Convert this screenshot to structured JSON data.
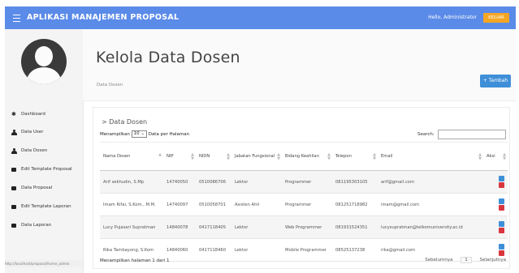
{
  "app": {
    "title": "APLIKASI MANAJEMEN PROPOSAL",
    "greeting": "Hello, Administrator",
    "logout_label": "KELUAR",
    "status_url": "http://localhost/proposal/home_admin"
  },
  "sidebar": {
    "items": [
      {
        "label": "Dashboard",
        "icon": "dashboard-icon"
      },
      {
        "label": "Data User",
        "icon": "user-icon"
      },
      {
        "label": "Data Dosen",
        "icon": "user-icon"
      },
      {
        "label": "Edit Template Proposal",
        "icon": "file-icon"
      },
      {
        "label": "Data Proposal",
        "icon": "file-icon"
      },
      {
        "label": "Edit Template Laporan",
        "icon": "file-icon"
      },
      {
        "label": "Data Laporan",
        "icon": "file-icon"
      }
    ]
  },
  "header": {
    "title": "Kelola Data Dosen",
    "breadcrumb": "Data Dosen",
    "add_button": "+ Tambah"
  },
  "panel": {
    "breadcrumb": "> Data Dosen",
    "length_prefix": "Menampilkan",
    "length_value": "10",
    "length_suffix": "Data per Halaman",
    "search_label": "Search:",
    "search_value": "",
    "columns": [
      "Nama Dosen",
      "NIP",
      "NIDN",
      "Jabatan Fungsional",
      "Bidang Keahlian",
      "Telepon",
      "Email",
      "Aksi"
    ],
    "rows": [
      [
        "Arif sekhudin, S.Mp",
        "14740050",
        "0510086706",
        "Lektor",
        "Programmer",
        "081195303105",
        "arif@gmail.com"
      ],
      [
        "Imam Rifai, S.Kom., M.M.",
        "14740097",
        "0510058701",
        "Asisten Ahli",
        "Programmer",
        "081251718982",
        "imam@gmail.com"
      ],
      [
        "Lucy Pujasari Supratman",
        "14840078",
        "0417118405",
        "Lektor",
        "Web Programmer",
        "081931524351",
        "lucysupratman@telkomuniversity.ac.id"
      ],
      [
        "Rika Tambayong, S.Kom",
        "14840060",
        "0417118460",
        "Lektor",
        "Mobile Programmer",
        "08525137238",
        "rika@gmail.com"
      ]
    ],
    "info": "Menampilkan halaman 1 dari 1",
    "prev": "Sebelumnya",
    "page": "1",
    "next": "Selanjutnya"
  },
  "colors": {
    "topbar": "#5b8be8",
    "logout": "#f5a623",
    "primary": "#3f8fd8",
    "danger": "#d9363e"
  }
}
